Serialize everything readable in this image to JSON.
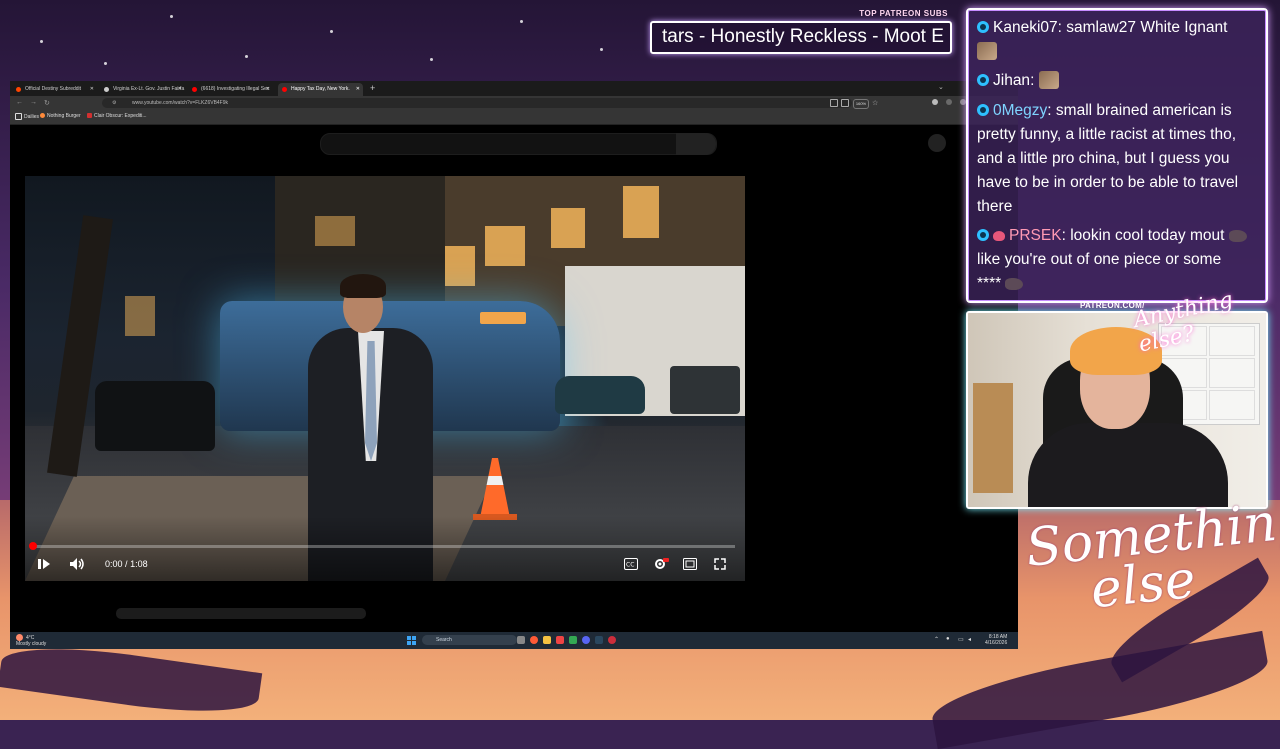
{
  "overlay": {
    "top_subs_label": "TOP PATREON SUBS",
    "ticker_text": "tars - Honestly Reckless - Moot E",
    "patreon_url": "PATREON.COM/",
    "patreon_logo_text": "Anything else?",
    "brand_text_line1": "Something",
    "brand_text_line2": "else"
  },
  "browser": {
    "tabs": [
      {
        "label": "Official Destiny Subreddit",
        "color": "#ff4500"
      },
      {
        "label": "Virginia Ex-Lt. Gov. Justin Fairfa",
        "color": "#cccccc"
      },
      {
        "label": "(6618) Investigating Illegal Sec",
        "color": "#ff0000"
      },
      {
        "label": "Happy Tax Day, New York.",
        "color": "#ff0000"
      }
    ],
    "active_tab_index": 3,
    "new_tab_glyph": "+",
    "url": "www.youtube.com/watch?v=FLKZ6VB4F9k",
    "zoom": "160%",
    "bookmarks": [
      {
        "label": "Dailies",
        "color": "#dddddd"
      },
      {
        "label": "Nothing Burger",
        "color": "#ff8a3a"
      },
      {
        "label": "Clair Obscur: Expediti...",
        "color": "#d23030"
      }
    ]
  },
  "player": {
    "time_current": "0:00",
    "time_total": "1:08",
    "progress": 0.0,
    "controls": [
      "play-icon",
      "volume-icon",
      "captions-icon",
      "settings-icon",
      "theater-icon",
      "fullscreen-icon"
    ]
  },
  "taskbar": {
    "weather_temp": "4°C",
    "weather_desc": "Mostly cloudy",
    "search_placeholder": "Search",
    "clock_time": "8:18 AM",
    "clock_date": "4/16/2026"
  },
  "chat": {
    "messages": [
      {
        "user": "Kaneki07",
        "text": "samlaw27 White Ignant",
        "user_color": "#ffffff"
      },
      {
        "user": "Jihan",
        "text": "",
        "user_color": "#ffffff"
      },
      {
        "user": "0Megzy",
        "text": "small brained american is pretty funny, a little racist at times tho, and a little pro china, but I guess you have to be in order to be able to travel there",
        "user_color": "#7fd4ff"
      },
      {
        "user": "PRSEK",
        "text_a": "lookin cool today mout",
        "text_b": "like you're out of one piece or some ****",
        "user_color": "#ff9ab4"
      }
    ]
  }
}
